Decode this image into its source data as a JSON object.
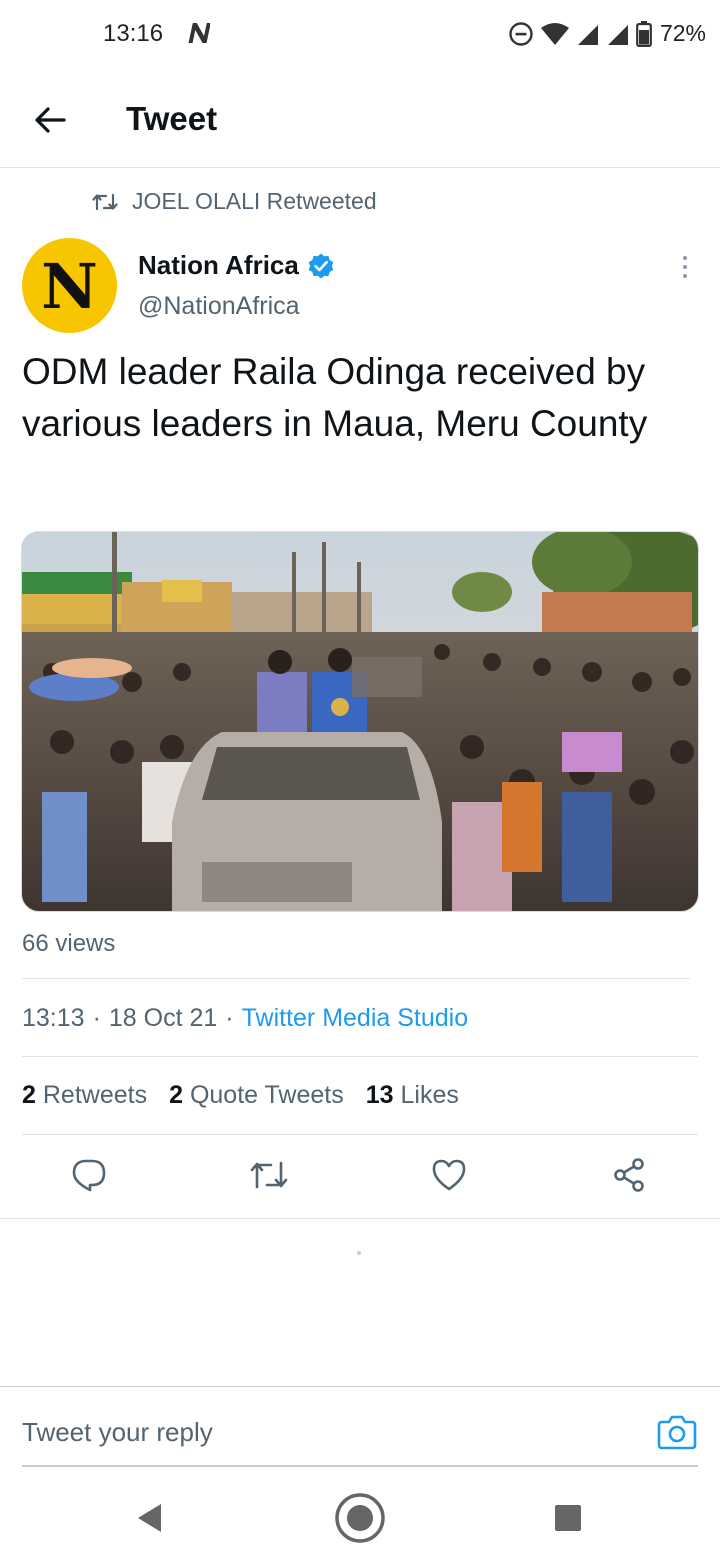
{
  "status_bar": {
    "time": "13:16",
    "battery": "72%"
  },
  "header": {
    "title": "Tweet"
  },
  "retweet_context": {
    "text": "JOEL OLALI Retweeted"
  },
  "author": {
    "avatar_letter": "N",
    "name": "Nation Africa",
    "handle": "@NationAfrica",
    "verified": true
  },
  "tweet": {
    "text": "ODM leader Raila Odinga received by various leaders in Maua, Meru County",
    "views": "66 views",
    "time": "13:13",
    "date": "18 Oct 21",
    "source": "Twitter Media Studio"
  },
  "stats": {
    "retweets_count": "2",
    "retweets_label": "Retweets",
    "quotes_count": "2",
    "quotes_label": "Quote Tweets",
    "likes_count": "13",
    "likes_label": "Likes"
  },
  "reply": {
    "placeholder": "Tweet your reply"
  },
  "colors": {
    "accent": "#1d9bf0",
    "avatar_bg": "#f7c600",
    "secondary_text": "#536471"
  },
  "icons": {
    "back": "arrow-left-icon",
    "retweet": "retweet-icon",
    "verified": "verified-badge-icon",
    "more": "more-vertical-icon",
    "reply": "reply-icon",
    "like": "heart-icon",
    "share": "share-icon",
    "camera": "camera-icon"
  }
}
